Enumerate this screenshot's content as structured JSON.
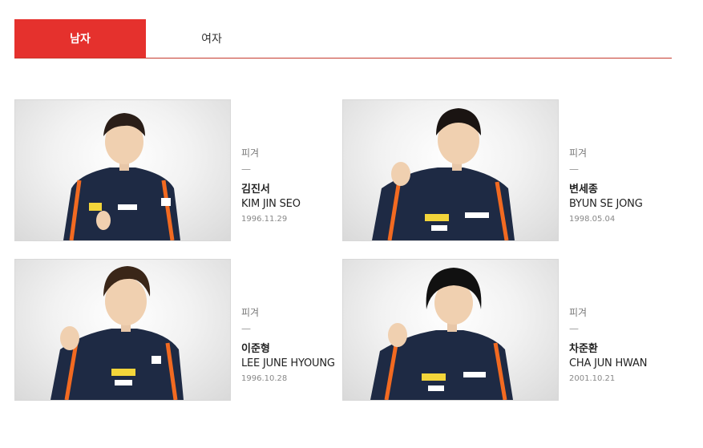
{
  "tabs": [
    {
      "label": "남자",
      "active": true
    },
    {
      "label": "여자",
      "active": false
    }
  ],
  "athletes": [
    {
      "sport": "피겨",
      "dash": "—",
      "name_ko": "김진서",
      "name_en": "KIM JIN SEO",
      "dob": "1996.11.29"
    },
    {
      "sport": "피겨",
      "dash": "—",
      "name_ko": "변세종",
      "name_en": "BYUN SE JONG",
      "dob": "1998.05.04"
    },
    {
      "sport": "피겨",
      "dash": "—",
      "name_ko": "이준형",
      "name_en": "LEE JUNE HYOUNG",
      "dob": "1996.10.28"
    },
    {
      "sport": "피겨",
      "dash": "—",
      "name_ko": "차준환",
      "name_en": "CHA JUN HWAN",
      "dob": "2001.10.21"
    }
  ],
  "colors": {
    "accent": "#e5312d",
    "jacket": "#1e2a44",
    "stripe": "#f26a21"
  }
}
